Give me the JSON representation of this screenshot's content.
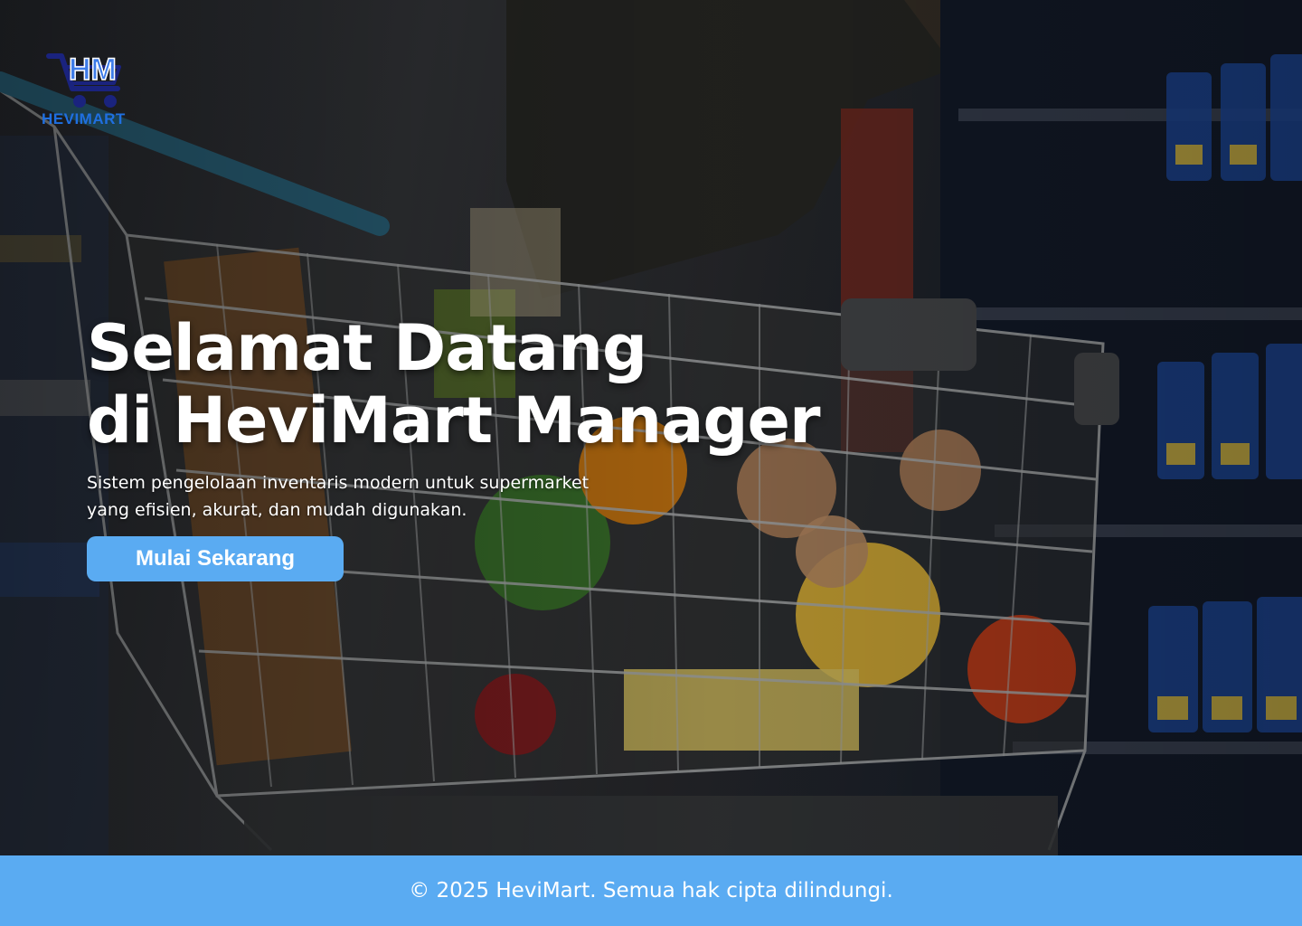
{
  "brand": {
    "logo_monogram": "HM",
    "name": "HEVIMART",
    "logo_icon": "shopping-cart-icon",
    "color": "#1f6fe0"
  },
  "hero": {
    "title_line1": "Selamat Datang",
    "title_line2": "di HeviMart Manager",
    "subtitle_line1": "Sistem pengelolaan inventaris modern untuk supermarket",
    "subtitle_line2": "yang efisien, akurat, dan mudah digunakan.",
    "cta_label": "Mulai Sekarang",
    "background_image": "shopping-cart-supermarket-aisle"
  },
  "footer": {
    "text": "© 2025 HeviMart. Semua hak cipta dilindungi."
  },
  "colors": {
    "accent": "#5aabf2",
    "text": "#ffffff"
  }
}
